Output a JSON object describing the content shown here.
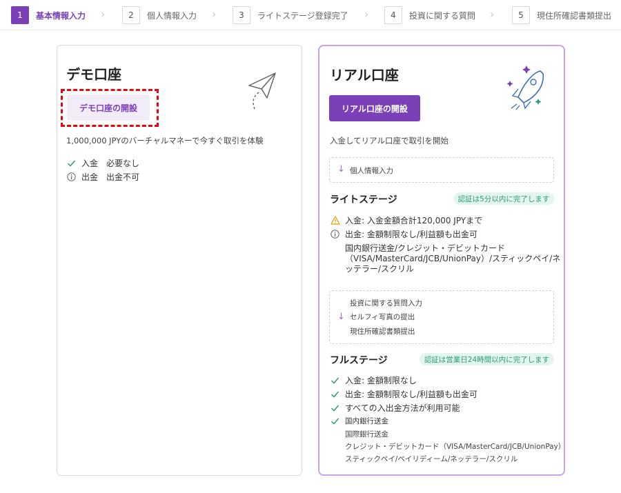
{
  "stepper": {
    "steps": [
      {
        "num": "1",
        "label": "基本情報入力"
      },
      {
        "num": "2",
        "label": "個人情報入力"
      },
      {
        "num": "3",
        "label": "ライトステージ登録完了"
      },
      {
        "num": "4",
        "label": "投資に関する質問"
      },
      {
        "num": "5",
        "label": "現住所確認書類提出"
      }
    ]
  },
  "demo": {
    "title": "デモ口座",
    "button": "デモ口座の開設",
    "description": "1,000,000 JPYのバーチャルマネーで今すぐ取引を体験",
    "deposit_key": "入金",
    "deposit_val": "必要なし",
    "withdraw_key": "出金",
    "withdraw_val": "出金不可"
  },
  "real": {
    "title": "リアル口座",
    "button": "リアル口座の開設",
    "description": "入金してリアル口座で取引を開始",
    "step_personal": "個人情報入力",
    "light": {
      "title": "ライトステージ",
      "badge": "認証は5分以内に完了します",
      "deposit": "入金: 入金金額合計120,000 JPYまで",
      "withdraw": "出金: 金額制限なし/利益額も出金可",
      "methods_line1": "国内銀行送金/クレジット・デビットカード",
      "methods_line2": "（VISA/MasterCard/JCB/UnionPay）/スティックペイ/ネ",
      "methods_line3": "ッテラー/スクリル"
    },
    "steps_box": {
      "line1": "投資に関する質問入力",
      "line2": "セルフィ写真の提出",
      "line3": "現住所確認書類提出"
    },
    "full": {
      "title": "フルステージ",
      "badge": "認証は営業日24時間以内に完了します",
      "item1": "入金: 金額制限なし",
      "item2": "出金: 金額制限なし/利益額も出金可",
      "item3": "すべての入出金方法が利用可能",
      "method1": "国内銀行送金",
      "method2": "国際銀行送金",
      "method3": "クレジット・デビットカード（VISA/MasterCard/JCB/UnionPay）",
      "method4": "スティックペイ/ペイリディーム/ネッテラー/スクリル"
    }
  },
  "icons": {
    "check": "check-icon",
    "info": "info-icon",
    "warning": "warning-icon",
    "arrow": "arrow-down-icon",
    "plane": "paper-plane-icon",
    "rocket": "rocket-icon",
    "chevron": "chevron-right-icon"
  },
  "colors": {
    "accent": "#7b3fb8",
    "accent_light": "#f2ecf8",
    "highlight": "#e1070f",
    "success": "#2e9a7a",
    "badge_bg": "#e3f5ef",
    "warning": "#e0a000"
  }
}
